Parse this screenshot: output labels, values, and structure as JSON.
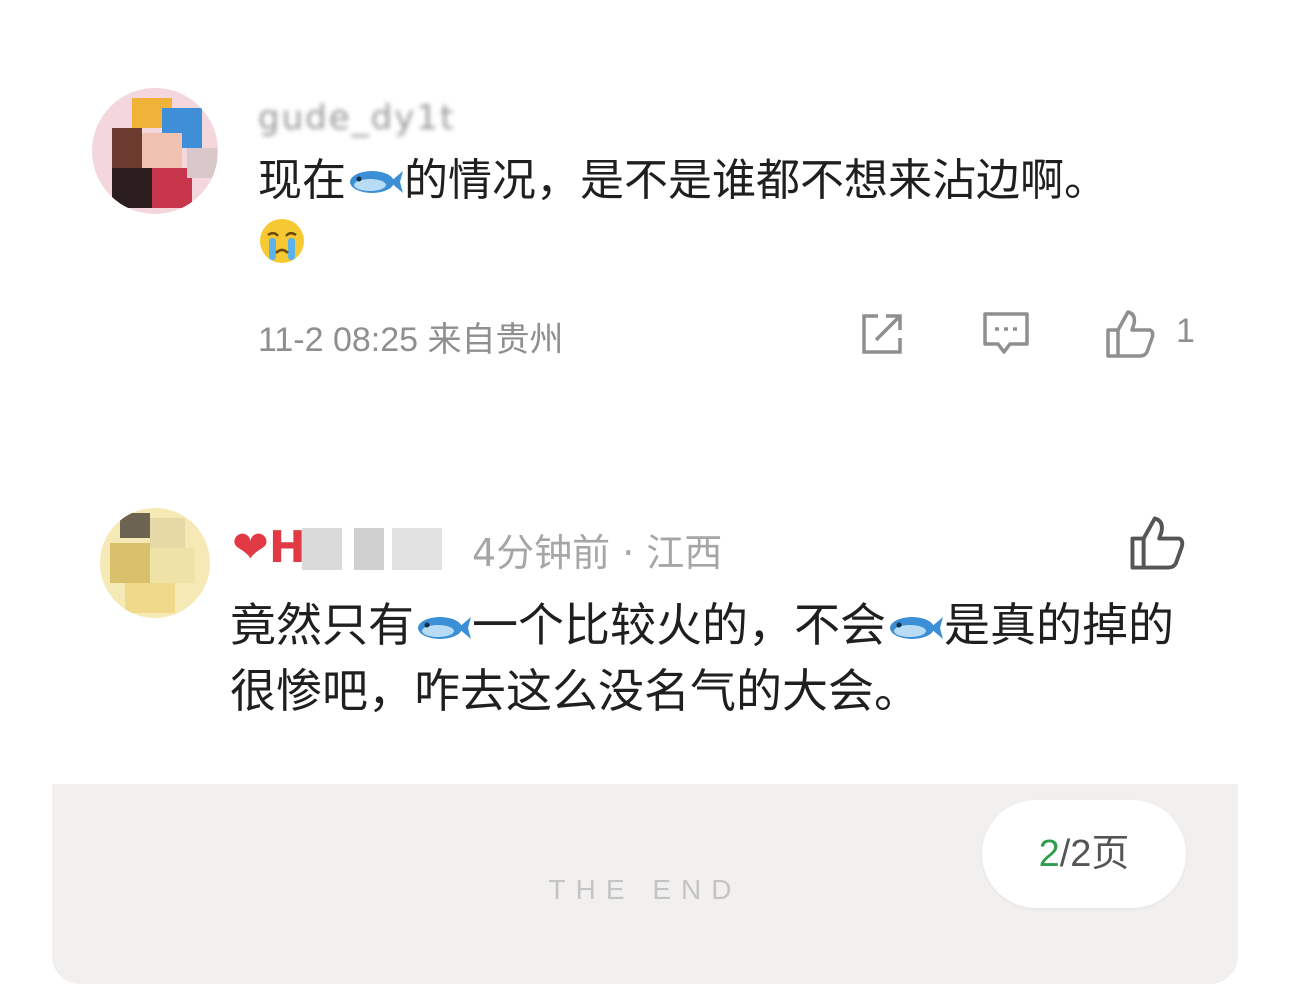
{
  "comments": [
    {
      "username": "gude_dy1t",
      "text_before": "现在",
      "text_middle": "的情况，是不是谁都不想来沾边啊。",
      "emoji_1": "fish-emoji",
      "emoji_2": "crying-face-emoji",
      "time": "11-2 08:25",
      "location": "来自贵州",
      "likes": "1",
      "icons": [
        "share-icon",
        "reply-icon",
        "thumbs-up-icon"
      ]
    },
    {
      "username": "❤H",
      "time_location": "4分钟前 · 江西",
      "text_a": "竟然只有",
      "text_b": "一个比较火的，不会",
      "text_c": "是真的掉的很惨吧，咋去这么没名气的大会。",
      "emoji": "fish-emoji",
      "icons": [
        "thumbs-up-icon"
      ]
    }
  ],
  "footer": {
    "end_label": "THE END",
    "page_current": "2",
    "page_total": "/2页"
  },
  "colors": {
    "accent_green": "#2f9d4d",
    "panel_bg": "#f1f0ee",
    "meta_gray": "#8f8f8f"
  }
}
